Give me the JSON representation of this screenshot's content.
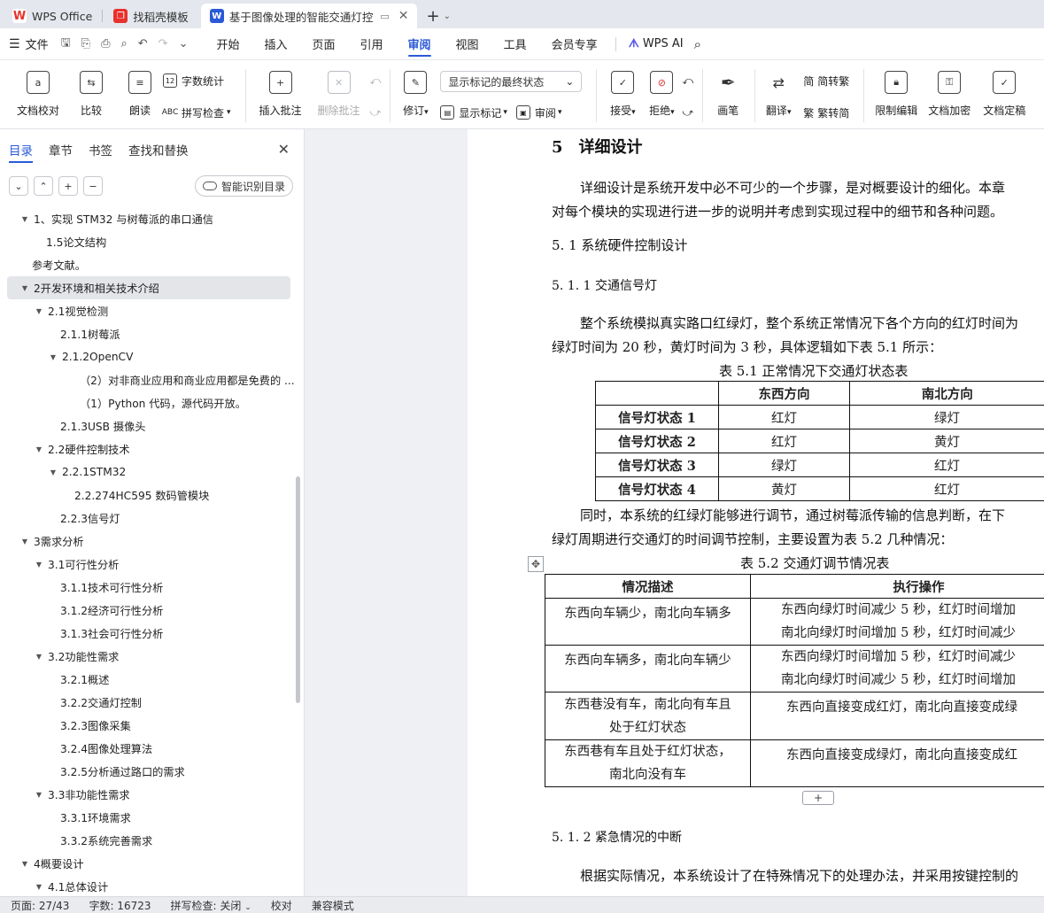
{
  "tabs": [
    {
      "label": "WPS Office",
      "icon": "wps-logo-icon",
      "color": "#e8322d"
    },
    {
      "label": "找稻壳模板",
      "icon": "docer-icon",
      "color": "#e8322d"
    },
    {
      "label": "基于图像处理的智能交通灯控",
      "icon": "writer-doc-icon",
      "color": "#2a5ad7"
    }
  ],
  "menu": {
    "file": "文件",
    "items": [
      "开始",
      "插入",
      "页面",
      "引用",
      "审阅",
      "视图",
      "工具",
      "会员专享"
    ],
    "active": "审阅",
    "ai": "WPS AI"
  },
  "ribbon": {
    "doc_check": "文档校对",
    "compare": "比较",
    "read_aloud": "朗读",
    "word_count": "字数统计",
    "spell_check": "拼写检查",
    "insert_comment": "插入批注",
    "delete_comment": "删除批注",
    "track_changes": "修订",
    "markup_select": "显示标记的最终状态",
    "show_markup": "显示标记",
    "review_pane": "审阅",
    "accept": "接受",
    "reject": "拒绝",
    "pen": "画笔",
    "translate": "翻译",
    "to_traditional": "简转繁",
    "to_simplified": "繁转简",
    "restrict_edit": "限制编辑",
    "encrypt": "文档加密",
    "finalize": "文档定稿"
  },
  "nav": {
    "tabs": [
      "目录",
      "章节",
      "书签",
      "查找和替换"
    ],
    "smart_toc": "智能识别目录",
    "toc": [
      {
        "text": "1、实现 STM32 与树莓派的串口通信",
        "level": 1,
        "arrow": "expanded"
      },
      {
        "text": "1.5论文结构",
        "level": 2,
        "arrow": "none"
      },
      {
        "text": "参考文献。",
        "level": 0,
        "arrow": "none"
      },
      {
        "text": "2开发环境和相关技术介绍",
        "level": 1,
        "arrow": "expanded",
        "selected": true
      },
      {
        "text": "2.1视觉检测",
        "level": 2,
        "arrow": "expanded"
      },
      {
        "text": "2.1.1树莓派",
        "level": 3,
        "arrow": "none"
      },
      {
        "text": "2.1.2OpenCV",
        "level": 3,
        "arrow": "expanded"
      },
      {
        "text": "（2）对非商业应用和商业应用都是免费的 ...",
        "level": 4,
        "arrow": "none"
      },
      {
        "text": "（1）Python 代码，源代码开放。",
        "level": 4,
        "arrow": "none"
      },
      {
        "text": "2.1.3USB 摄像头",
        "level": 3,
        "arrow": "none"
      },
      {
        "text": "2.2硬件控制技术",
        "level": 2,
        "arrow": "expanded"
      },
      {
        "text": "2.2.1STM32",
        "level": 3,
        "arrow": "expanded"
      },
      {
        "text": "2.2.274HC595 数码管模块",
        "level": 4,
        "arrow": "none"
      },
      {
        "text": "2.2.3信号灯",
        "level": 3,
        "arrow": "none"
      },
      {
        "text": "3需求分析",
        "level": 1,
        "arrow": "expanded"
      },
      {
        "text": "3.1可行性分析",
        "level": 2,
        "arrow": "expanded"
      },
      {
        "text": "3.1.1技术可行性分析",
        "level": 3,
        "arrow": "none"
      },
      {
        "text": "3.1.2经济可行性分析",
        "level": 3,
        "arrow": "none"
      },
      {
        "text": "3.1.3社会可行性分析",
        "level": 3,
        "arrow": "none"
      },
      {
        "text": "3.2功能性需求",
        "level": 2,
        "arrow": "expanded"
      },
      {
        "text": "3.2.1概述",
        "level": 3,
        "arrow": "none"
      },
      {
        "text": "3.2.2交通灯控制",
        "level": 3,
        "arrow": "none"
      },
      {
        "text": "3.2.3图像采集",
        "level": 3,
        "arrow": "none"
      },
      {
        "text": "3.2.4图像处理算法",
        "level": 3,
        "arrow": "none"
      },
      {
        "text": "3.2.5分析通过路口的需求",
        "level": 3,
        "arrow": "none"
      },
      {
        "text": "3.3非功能性需求",
        "level": 2,
        "arrow": "expanded"
      },
      {
        "text": "3.3.1环境需求",
        "level": 3,
        "arrow": "none"
      },
      {
        "text": "3.3.2系统完善需求",
        "level": 3,
        "arrow": "none"
      },
      {
        "text": "4概要设计",
        "level": 1,
        "arrow": "expanded"
      },
      {
        "text": "4.1总体设计",
        "level": 2,
        "arrow": "expanded"
      }
    ]
  },
  "doc": {
    "h1": "5　详细设计",
    "p1a": "详细设计是系统开发中必不可少的一个步骤，是对概要设计的细化。本章",
    "p1b": "对每个模块的实现进行进一步的说明并考虑到实现过程中的细节和各种问题。",
    "h2": "5. 1  系统硬件控制设计",
    "h3a": "5. 1. 1  交通信号灯",
    "p2a": "整个系统模拟真实路口红绿灯，整个系统正常情况下各个方向的红灯时间为",
    "p2b": "绿灯时间为  20 秒，黄灯时间为  3 秒，具体逻辑如下表  5.1 所示：",
    "t1_caption": "表  5.1 正常情况下交通灯状态表",
    "t1_headers": [
      "",
      "东西方向",
      "南北方向"
    ],
    "t1_rows": [
      [
        "信号灯状态  1",
        "红灯",
        "绿灯"
      ],
      [
        "信号灯状态  2",
        "红灯",
        "黄灯"
      ],
      [
        "信号灯状态  3",
        "绿灯",
        "红灯"
      ],
      [
        "信号灯状态  4",
        "黄灯",
        "红灯"
      ]
    ],
    "p3a": "同时，本系统的红绿灯能够进行调节，通过树莓派传输的信息判断，在下",
    "p3b": "绿灯周期进行交通灯的时间调节控制，主要设置为表  5.2 几种情况：",
    "t2_caption": "表  5.2 交通灯调节情况表",
    "t2_headers": [
      "情况描述",
      "执行操作"
    ],
    "t2_rows": [
      [
        "东西向车辆少，南北向车辆多",
        "",
        "东西向绿灯时间减少  5 秒，红灯时间增加",
        "南北向绿灯时间增加  5 秒，红灯时间减少"
      ],
      [
        "东西向车辆多，南北向车辆少",
        "",
        "东西向绿灯时间增加  5 秒，红灯时间减少",
        "南北向绿灯时间减少  5 秒，红灯时间增加"
      ],
      [
        "东西巷没有车，南北向有车且",
        "处于红灯状态",
        "东西向直接变成红灯，南北向直接变成绿",
        ""
      ],
      [
        "东西巷有车且处于红灯状态，",
        "南北向没有车",
        "东西向直接变成绿灯，南北向直接变成红",
        ""
      ]
    ],
    "h3b": "5. 1. 2  紧急情况的中断",
    "p4a": "根据实际情况，本系统设计了在特殊情况下的处理办法，并采用按键控制的"
  },
  "status": {
    "page": "页面: 27/43",
    "words": "字数: 16723",
    "spell": "拼写检查: 关闭",
    "proof": "校对",
    "compat": "兼容模式"
  }
}
